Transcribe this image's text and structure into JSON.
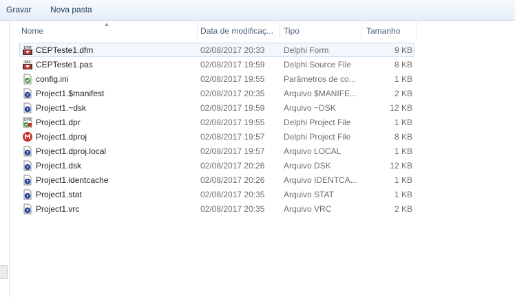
{
  "toolbar": {
    "save_label": "Gravar",
    "new_folder_label": "Nova pasta"
  },
  "columns": {
    "name": "Nome",
    "date": "Data de modificaç...",
    "type": "Tipo",
    "size": "Tamanho"
  },
  "files": [
    {
      "name": "CEPTeste1.dfm",
      "date": "02/08/2017 20:33",
      "type": "Delphi Form",
      "size": "9 KB",
      "icon": "delphi-form-icon",
      "selected": true
    },
    {
      "name": "CEPTeste1.pas",
      "date": "02/08/2017 19:59",
      "type": "Delphi Source File",
      "size": "8 KB",
      "icon": "delphi-source-icon"
    },
    {
      "name": "config.ini",
      "date": "02/08/2017 19:55",
      "type": "Parâmetros de co...",
      "size": "1 KB",
      "icon": "config-file-icon"
    },
    {
      "name": "Project1.$manifest",
      "date": "02/08/2017 20:35",
      "type": "Arquivo $MANIFE...",
      "size": "2 KB",
      "icon": "unknown-file-icon"
    },
    {
      "name": "Project1.~dsk",
      "date": "02/08/2017 19:59",
      "type": "Arquivo ~DSK",
      "size": "12 KB",
      "icon": "unknown-file-icon"
    },
    {
      "name": "Project1.dpr",
      "date": "02/08/2017 19:55",
      "type": "Delphi Project File",
      "size": "1 KB",
      "icon": "delphi-project-icon"
    },
    {
      "name": "Project1.dproj",
      "date": "02/08/2017 19:57",
      "type": "Delphi Project File",
      "size": "8 KB",
      "icon": "delphi-dproj-icon"
    },
    {
      "name": "Project1.dproj.local",
      "date": "02/08/2017 19:57",
      "type": "Arquivo LOCAL",
      "size": "1 KB",
      "icon": "unknown-file-icon"
    },
    {
      "name": "Project1.dsk",
      "date": "02/08/2017 20:26",
      "type": "Arquivo DSK",
      "size": "12 KB",
      "icon": "unknown-file-icon"
    },
    {
      "name": "Project1.identcache",
      "date": "02/08/2017 20:26",
      "type": "Arquivo IDENTCA...",
      "size": "1 KB",
      "icon": "unknown-file-icon"
    },
    {
      "name": "Project1.stat",
      "date": "02/08/2017 20:35",
      "type": "Arquivo STAT",
      "size": "1 KB",
      "icon": "unknown-file-icon"
    },
    {
      "name": "Project1.vrc",
      "date": "02/08/2017 20:35",
      "type": "Arquivo VRC",
      "size": "2 KB",
      "icon": "unknown-file-icon"
    }
  ],
  "icon_labels": {
    "dfm": "DFM",
    "pas": "PAS",
    "dpr": "DPR"
  },
  "colors": {
    "accent": "#1e395b",
    "selection": "#c7ddf3",
    "delphi_red": "#c8302a"
  }
}
